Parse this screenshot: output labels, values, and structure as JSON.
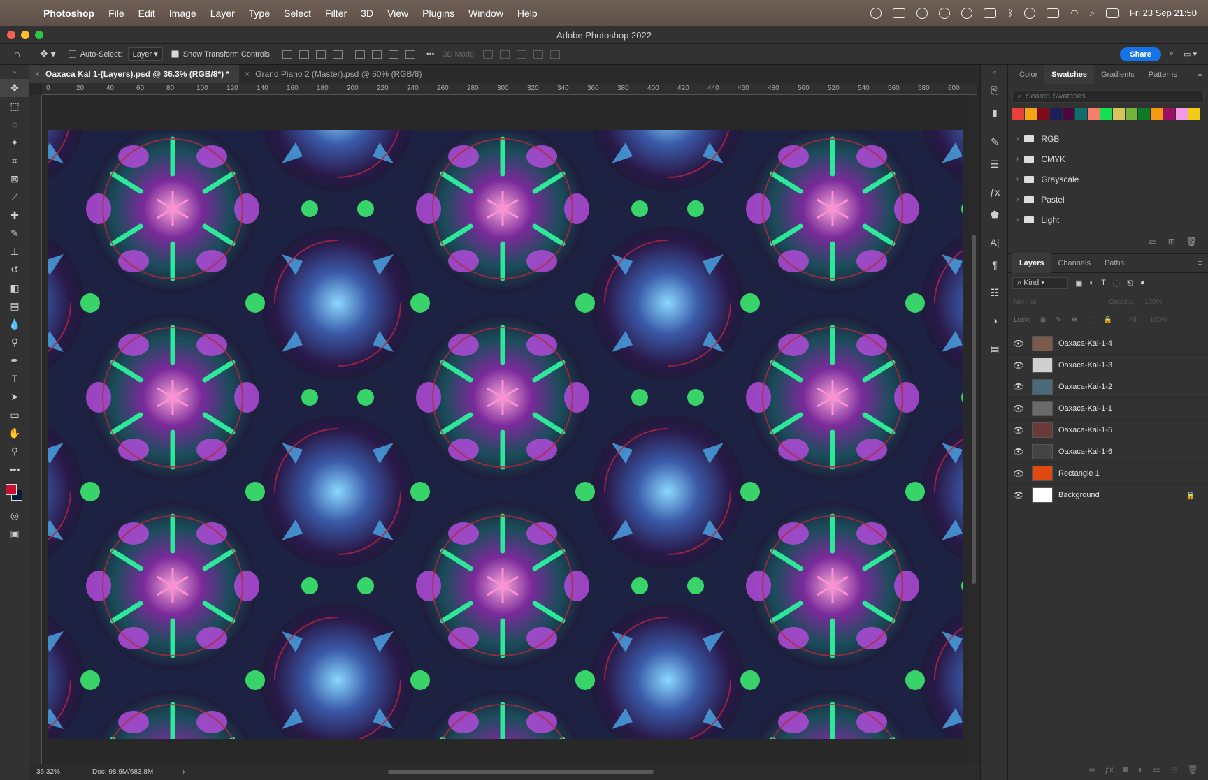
{
  "menubar": {
    "app_name": "Photoshop",
    "items": [
      "File",
      "Edit",
      "Image",
      "Layer",
      "Type",
      "Select",
      "Filter",
      "3D",
      "View",
      "Plugins",
      "Window",
      "Help"
    ],
    "clock": "Fri 23 Sep  21:50"
  },
  "window": {
    "title": "Adobe Photoshop 2022"
  },
  "options": {
    "auto_select_label": "Auto-Select:",
    "auto_select_value": "Layer",
    "transform_label": "Show Transform Controls",
    "mode_3d": "3D Mode:",
    "share_label": "Share"
  },
  "documents": [
    {
      "label": "Oaxaca Kal 1-(Layers).psd @ 36.3% (RGB/8*) *",
      "active": true
    },
    {
      "label": "Grand Piano 2 (Master).psd @ 50% (RGB/8)",
      "active": false
    }
  ],
  "ruler": {
    "h_ticks": [
      "0",
      "20",
      "40",
      "60",
      "80",
      "100",
      "120",
      "140",
      "160",
      "180",
      "200",
      "220",
      "240",
      "260",
      "280",
      "300",
      "320",
      "340",
      "360",
      "380",
      "400",
      "420",
      "440",
      "460",
      "480",
      "500",
      "520",
      "540",
      "560",
      "580",
      "600"
    ]
  },
  "status": {
    "zoom": "36.32%",
    "doc": "Doc: 98.9M/683.8M"
  },
  "swatches_panel": {
    "tabs": [
      "Color",
      "Swatches",
      "Gradients",
      "Patterns"
    ],
    "active_tab": "Swatches",
    "search_placeholder": "Search Swatches",
    "colors": [
      "#e8413c",
      "#f3a516",
      "#7e0b1c",
      "#1c1f5a",
      "#4a0a40",
      "#0e6f6c",
      "#f57f6a",
      "#16e050",
      "#d6c55a",
      "#72b53a",
      "#0e7a2a",
      "#f39a12",
      "#9a1063",
      "#f29ae8",
      "#f2cc12"
    ],
    "folders": [
      "RGB",
      "CMYK",
      "Grayscale",
      "Pastel",
      "Light"
    ]
  },
  "layers_panel": {
    "tabs": [
      "Layers",
      "Channels",
      "Paths"
    ],
    "active_tab": "Layers",
    "kind_label": "Kind",
    "blend_mode": "Normal",
    "opacity_label": "Opacity:",
    "opacity_value": "100%",
    "lock_label": "Lock:",
    "fill_label": "Fill:",
    "fill_value": "100%",
    "layers": [
      {
        "name": "Oaxaca-Kal-1-4",
        "thumb": "#7a5a4a"
      },
      {
        "name": "Oaxaca-Kal-1-3",
        "thumb": "#cfcfcf"
      },
      {
        "name": "Oaxaca-Kal-1-2",
        "thumb": "#4a6a7a"
      },
      {
        "name": "Oaxaca-Kal-1-1",
        "thumb": "#6a6a6a"
      },
      {
        "name": "Oaxaca-Kal-1-5",
        "thumb": "#6a3a3a"
      },
      {
        "name": "Oaxaca-Kal-1-6",
        "thumb": "#444"
      },
      {
        "name": "Rectangle 1",
        "thumb": "#e04a10"
      },
      {
        "name": "Background",
        "thumb": "#ffffff"
      }
    ]
  },
  "tools": [
    "move-tool",
    "marquee-tool",
    "lasso-tool",
    "magic-wand-tool",
    "crop-tool",
    "frame-tool",
    "eyedropper-tool",
    "healing-tool",
    "brush-tool",
    "stamp-tool",
    "history-brush-tool",
    "eraser-tool",
    "gradient-tool",
    "blur-tool",
    "dodge-tool",
    "pen-tool",
    "type-tool",
    "path-select-tool",
    "rectangle-tool",
    "hand-tool",
    "zoom-tool",
    "more-tools"
  ]
}
